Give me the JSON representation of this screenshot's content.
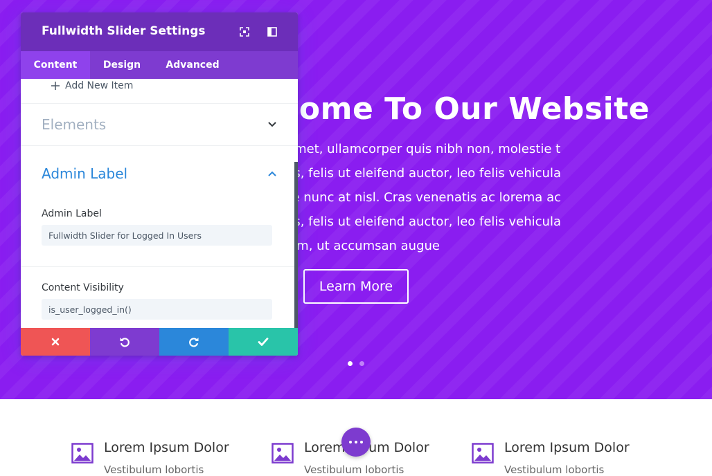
{
  "hero": {
    "title": "Welcome To Our Website",
    "lines": [
      "Lorem ipsum dolor sit amet, ullamcorper quis nibh non, molestie tempus",
      "Donec vehicula sapien in tellus, felis ut eleifend auctor, leo felis vehicula",
      "Aenean sed lorem quis tellus congue nunc at nisl. Cras venenatis ac lorema ac",
      "Donec vehicula sapien in tellus es, felis ut eleifend auctor, leo felis vehicula",
      "Sed gravida sit amet felis fermentum, ut accumsan augue."
    ],
    "button_label": "Learn More"
  },
  "panel": {
    "title": "Fullwidth Slider Settings",
    "tabs": [
      {
        "label": "Content"
      },
      {
        "label": "Design"
      },
      {
        "label": "Advanced"
      }
    ],
    "add_item_label": "Add New Item",
    "sections": {
      "elements": "Elements",
      "admin_label": "Admin Label"
    },
    "fields": {
      "admin_label": {
        "label": "Admin Label",
        "value": "Fullwidth Slider for Logged In Users"
      },
      "content_visibility": {
        "label": "Content Visibility",
        "value": "is_user_logged_in()"
      }
    }
  },
  "features": [
    {
      "title": "Lorem Ipsum Dolor",
      "subtitle": "Vestibulum lobortis"
    },
    {
      "title": "Lorem Ipsum Dolor",
      "subtitle": "Vestibulum lobortis"
    },
    {
      "title": "Lorem Ipsum Dolor",
      "subtitle": "Vestibulum lobortis"
    }
  ],
  "colors": {
    "hero_bg": "#8a1df0",
    "panel_header": "#6c2eb9",
    "cancel": "#ef5555",
    "undo": "#7e3bd0",
    "redo": "#2b87da",
    "save": "#29c4a9",
    "link_blue": "#2b87da"
  },
  "icons": {
    "cancel": "close-icon",
    "undo": "undo-icon",
    "redo": "redo-icon",
    "save": "checkmark-icon",
    "feature": "image-icon",
    "fab": "more-dots-icon"
  }
}
